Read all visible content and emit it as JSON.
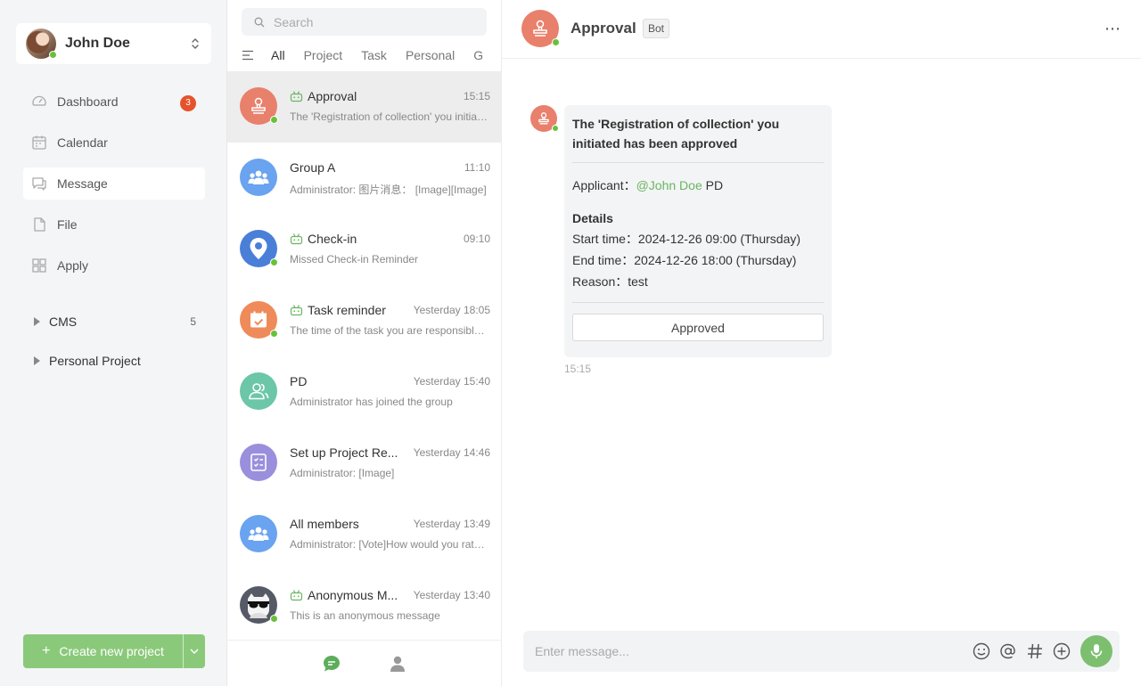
{
  "user": {
    "name": "John Doe"
  },
  "nav": [
    {
      "label": "Dashboard",
      "icon": "dashboard-icon",
      "badge": "3"
    },
    {
      "label": "Calendar",
      "icon": "calendar-icon"
    },
    {
      "label": "Message",
      "icon": "message-icon",
      "active": true
    },
    {
      "label": "File",
      "icon": "file-icon"
    },
    {
      "label": "Apply",
      "icon": "apply-grid-icon"
    }
  ],
  "folders": [
    {
      "label": "CMS",
      "count": "5"
    },
    {
      "label": "Personal Project",
      "count": ""
    }
  ],
  "create_button": {
    "label": "Create new project"
  },
  "search": {
    "placeholder": "Search"
  },
  "filters": {
    "tabs": [
      "All",
      "Project",
      "Task",
      "Personal",
      "G"
    ],
    "active": "All"
  },
  "conversations": [
    {
      "title": "Approval",
      "time": "15:15",
      "preview": "The 'Registration of collection' you initiated has been approved",
      "bot": true,
      "icon": "stamp-icon",
      "color": "#e8806c",
      "online": true
    },
    {
      "title": "Group A",
      "time": "11:10",
      "preview": "Administrator: 图片消息： [Image][Image]",
      "bot": false,
      "icon": "group-icon",
      "color": "#6aa3ef",
      "online": false
    },
    {
      "title": "Check-in",
      "time": "09:10",
      "preview": "Missed Check-in Reminder",
      "bot": true,
      "icon": "location-pin-icon",
      "color": "#4a7fd8",
      "online": true
    },
    {
      "title": "Task reminder",
      "time": "Yesterday 18:05",
      "preview": "The time of the task you are responsible for is approaching",
      "bot": true,
      "icon": "calendar-check-icon",
      "color": "#ef8b5a",
      "online": true
    },
    {
      "title": "PD",
      "time": "Yesterday 15:40",
      "preview": "Administrator has joined the group",
      "bot": false,
      "icon": "group-outline-icon",
      "color": "#6cc6a8",
      "online": false
    },
    {
      "title": "Set up Project Re...",
      "time": "Yesterday 14:46",
      "preview": "Administrator: [Image]",
      "bot": false,
      "icon": "checklist-icon",
      "color": "#9a8fdc",
      "online": false
    },
    {
      "title": "All members",
      "time": "Yesterday 13:49",
      "preview": "Administrator: [Vote]How would you rate this",
      "bot": false,
      "icon": "group-icon",
      "color": "#6aa3ef",
      "online": false
    },
    {
      "title": "Anonymous M...",
      "time": "Yesterday 13:40",
      "preview": "This is an anonymous message",
      "bot": true,
      "icon": "anonymous-icon",
      "color": "#555a66",
      "online": true
    }
  ],
  "chat": {
    "title": "Approval",
    "badge": "Bot",
    "card": {
      "title": "The 'Registration of collection' you initiated has been approved",
      "applicant_label": "Applicant：",
      "applicant_mention": "@John Doe",
      "applicant_suffix": " PD",
      "details_heading": "Details",
      "start": "Start time：2024-12-26 09:00 (Thursday)",
      "end": "End time：2024-12-26 18:00 (Thursday)",
      "reason": "Reason：test",
      "button": "Approved"
    },
    "message_time": "15:15",
    "composer_placeholder": "Enter message..."
  },
  "colors": {
    "accent": "#8bc97a",
    "online": "#67c23a",
    "badge": "#e5532d",
    "mention": "#6ab560"
  }
}
